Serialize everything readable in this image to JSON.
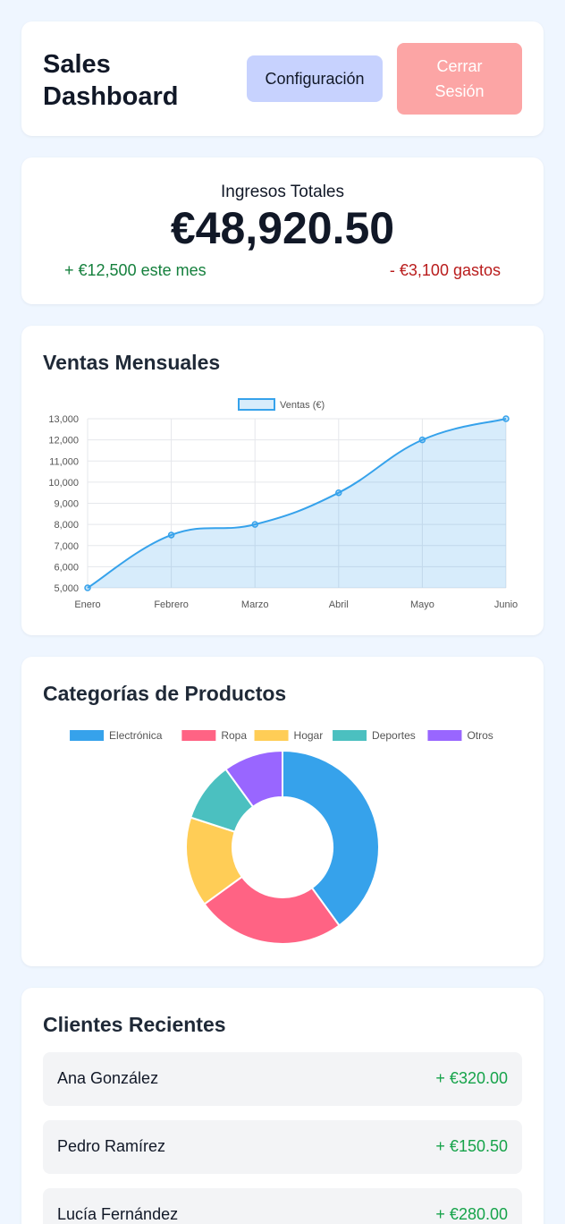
{
  "header": {
    "title": "Sales Dashboard",
    "settings_label": "Configuración",
    "logout_label": "Cerrar Sesión"
  },
  "revenue": {
    "label": "Ingresos Totales",
    "total": "€48,920.50",
    "income": "+ €12,500 este mes",
    "expenses": "- €3,100 gastos"
  },
  "sales_section": {
    "title": "Ventas Mensuales"
  },
  "categories_section": {
    "title": "Categorías de Productos"
  },
  "clients_section": {
    "title": "Clientes Recientes",
    "items": [
      {
        "name": "Ana González",
        "amount": "+ €320.00"
      },
      {
        "name": "Pedro Ramírez",
        "amount": "+ €150.50"
      },
      {
        "name": "Lucía Fernández",
        "amount": "+ €280.00"
      }
    ]
  },
  "chart_data": [
    {
      "type": "area",
      "categories": [
        "Enero",
        "Febrero",
        "Marzo",
        "Abril",
        "Mayo",
        "Junio"
      ],
      "series": [
        {
          "name": "Ventas (€)",
          "values": [
            5000,
            7500,
            8000,
            9500,
            12000,
            13000
          ],
          "color": "#36a2eb"
        }
      ],
      "ylim": [
        5000,
        13000
      ],
      "yticks": [
        5000,
        6000,
        7000,
        8000,
        9000,
        10000,
        11000,
        12000,
        13000
      ],
      "grid": true,
      "legend": "top-center"
    },
    {
      "type": "pie",
      "donut": true,
      "categories": [
        "Electrónica",
        "Ropa",
        "Hogar",
        "Deportes",
        "Otros"
      ],
      "values": [
        40,
        25,
        15,
        10,
        10
      ],
      "colors": [
        "#36a2eb",
        "#ff6384",
        "#ffcd56",
        "#4bc0c0",
        "#9966ff"
      ],
      "legend": "top-center"
    }
  ]
}
